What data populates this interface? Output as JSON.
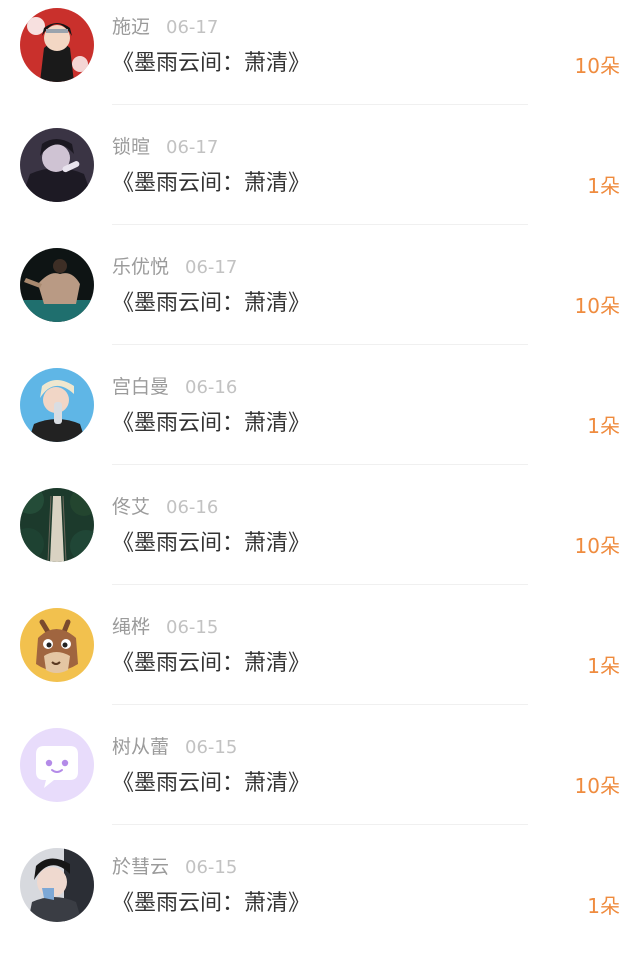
{
  "colors": {
    "name": "#9b9b9b",
    "date": "#c2c2c2",
    "gift": "#333333",
    "count": "#ef8b3e",
    "divider": "#f0f0f0"
  },
  "items": [
    {
      "name": "施迈",
      "date": "06-17",
      "gift": "《墨雨云间：萧清》",
      "count": "10朵",
      "avatar": "avatar-anime-red-cloak"
    },
    {
      "name": "锁暄",
      "date": "06-17",
      "gift": "《墨雨云间：萧清》",
      "count": "1朵",
      "avatar": "avatar-anime-dark"
    },
    {
      "name": "乐优悦",
      "date": "06-17",
      "gift": "《墨雨云间：萧清》",
      "count": "10朵",
      "avatar": "avatar-dancer-teal"
    },
    {
      "name": "宫白曼",
      "date": "06-16",
      "gift": "《墨雨云间：萧清》",
      "count": "1朵",
      "avatar": "avatar-blonde-drink"
    },
    {
      "name": "佟艾",
      "date": "06-16",
      "gift": "《墨雨云间：萧清》",
      "count": "10朵",
      "avatar": "avatar-forest-bridge"
    },
    {
      "name": "绳桦",
      "date": "06-15",
      "gift": "《墨雨云间：萧清》",
      "count": "1朵",
      "avatar": "avatar-cartoon-horse"
    },
    {
      "name": "树从蕾",
      "date": "06-15",
      "gift": "《墨雨云间：萧清》",
      "count": "10朵",
      "avatar": "avatar-chat-bubble"
    },
    {
      "name": "於彗云",
      "date": "06-15",
      "gift": "《墨雨云间：萧清》",
      "count": "1朵",
      "avatar": "avatar-masked-person"
    }
  ]
}
